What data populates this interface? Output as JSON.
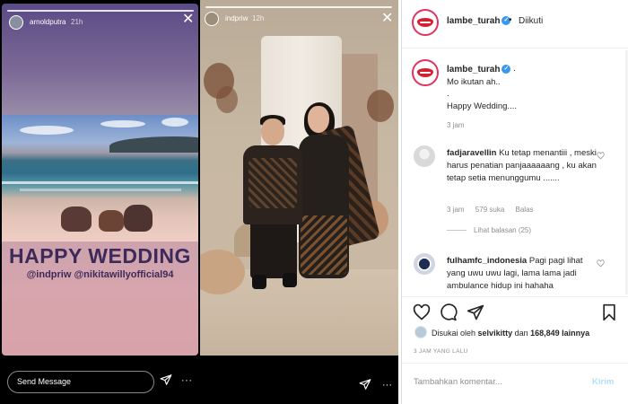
{
  "story1": {
    "username": "arnoldputra",
    "time": "21h",
    "close": "✕",
    "title": "HAPPY WEDDING",
    "mentions": "@indpriw @nikitawillyofficial94",
    "send_placeholder": "Send Message",
    "more": "···"
  },
  "story2": {
    "username": "indpriw",
    "time": "12h",
    "close": "✕",
    "more": "···"
  },
  "post": {
    "header": {
      "username": "lambe_turah",
      "verified": "✓",
      "dot": "•",
      "follow_status": "Diikuti"
    },
    "caption": {
      "username": "lambe_turah",
      "verified": "✓",
      "dot": ".",
      "lines": [
        "Mo ikutan ah..",
        ".",
        "Happy Wedding...."
      ],
      "time": "3 jam"
    },
    "comments": [
      {
        "username": "fadjaravellin",
        "text": "Ku tetap menantiii , meski harus penatian panjaaaaaang , ku akan tetap setia menunggumu .......",
        "time": "3 jam",
        "likes": "579 suka",
        "reply": "Balas",
        "view_replies": "Lihat balasan (25)"
      },
      {
        "username": "fulhamfc_indonesia",
        "text": "Pagi pagi lihat yang uwu uwu lagi, lama lama jadi ambulance hidup ini",
        "trailing": "hahaha"
      }
    ],
    "liked_by_prefix": "Disukai oleh",
    "liked_by_user": "selvikitty",
    "liked_by_connector": "dan",
    "liked_count": "168,849 lainnya",
    "time_ago": "3 JAM YANG LALU",
    "comment_placeholder": "Tambahkan komentar...",
    "post_button": "Kirim"
  },
  "colors": {
    "accent": "#3897f0",
    "brand_red": "#d4202f",
    "ring": "#e3325f",
    "muted": "#8e8e8e"
  }
}
